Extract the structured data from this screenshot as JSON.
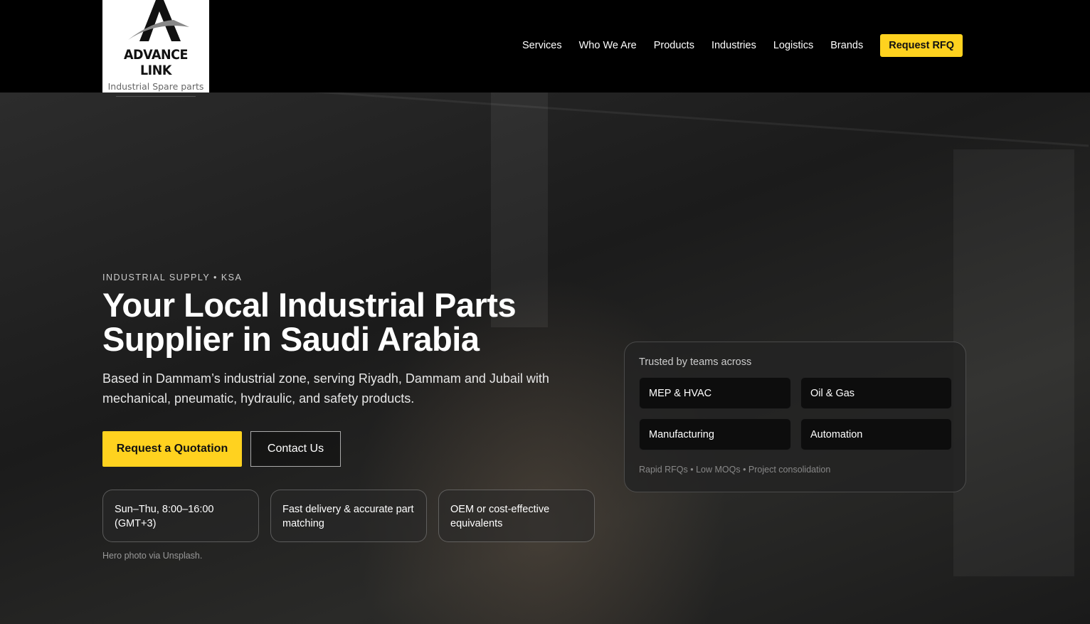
{
  "brand": {
    "name": "ADVANCE LINK",
    "tagline": "Industrial Spare parts"
  },
  "nav": {
    "items": [
      "Services",
      "Who We Are",
      "Products",
      "Industries",
      "Logistics",
      "Brands"
    ],
    "cta": "Request RFQ"
  },
  "hero": {
    "eyebrow": "INDUSTRIAL SUPPLY • KSA",
    "title_line1": "Your Local Industrial Parts",
    "title_line2": "Supplier in Saudi Arabia",
    "lead": "Based in Dammam’s industrial zone, serving Riyadh, Dammam and Jubail with mechanical, pneumatic, hydraulic, and safety products.",
    "primary_cta": "Request a Quotation",
    "secondary_cta": "Contact Us",
    "features": [
      "Sun–Thu, 8:00–16:00 (GMT+3)",
      "Fast delivery & accurate part matching",
      "OEM or cost-effective equivalents"
    ],
    "credit": "Hero photo via Unsplash."
  },
  "trust": {
    "title": "Trusted by teams across",
    "industries": [
      "MEP & HVAC",
      "Oil & Gas",
      "Manufacturing",
      "Automation"
    ],
    "footer": "Rapid RFQs • Low MOQs • Project consolidation"
  },
  "colors": {
    "accent": "#ffd21f",
    "background": "#000000"
  }
}
